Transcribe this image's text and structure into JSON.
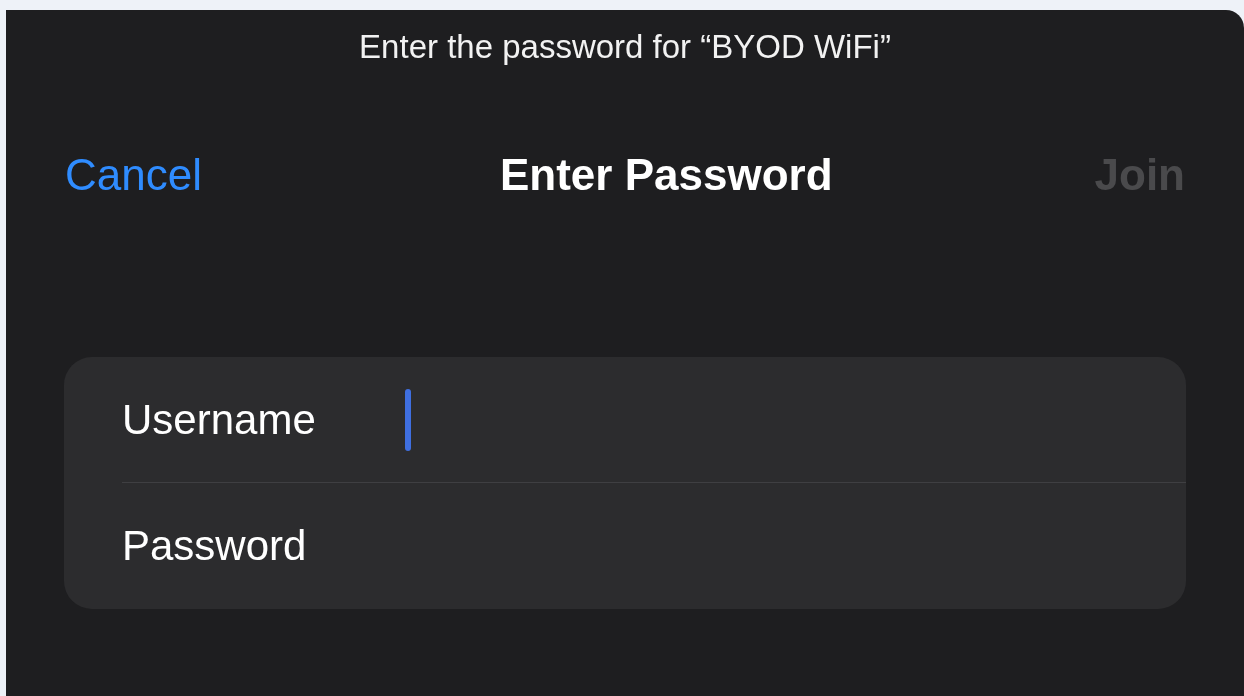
{
  "prompt": "Enter the password for “BYOD WiFi”",
  "nav": {
    "cancel": "Cancel",
    "title": "Enter Password",
    "join": {
      "label": "Join",
      "disabled": true
    }
  },
  "fields": [
    {
      "label": "Username",
      "focused": true
    },
    {
      "label": "Password",
      "focused": false
    }
  ]
}
